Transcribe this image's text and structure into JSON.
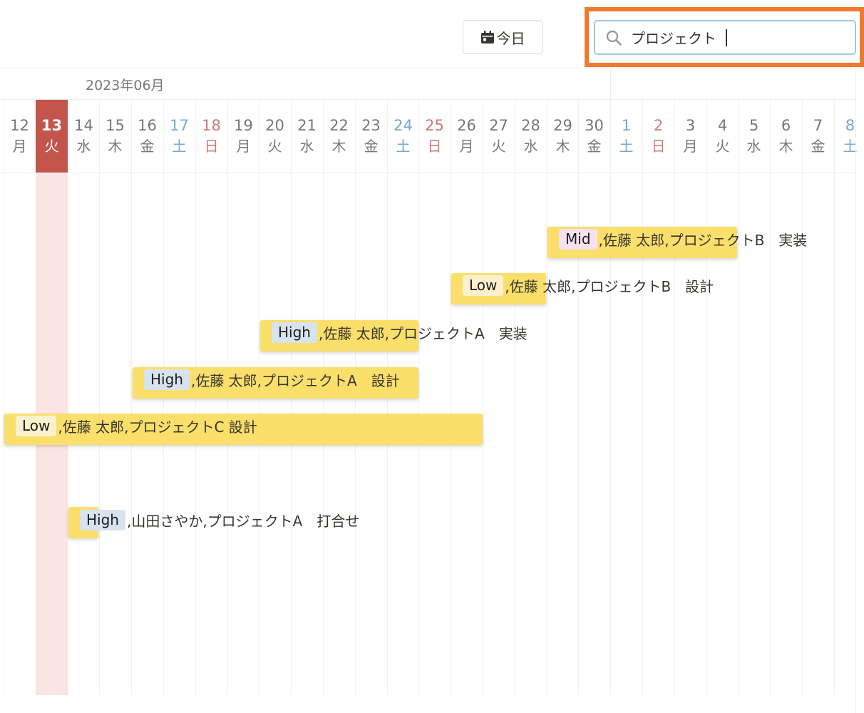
{
  "toolbar": {
    "today_label": "今日",
    "search_value": "プロジェクト"
  },
  "calendar": {
    "month_label": "2023年06月",
    "days": [
      {
        "num": "12",
        "wd": "月",
        "type": "normal"
      },
      {
        "num": "13",
        "wd": "火",
        "type": "today"
      },
      {
        "num": "14",
        "wd": "水",
        "type": "normal"
      },
      {
        "num": "15",
        "wd": "木",
        "type": "normal"
      },
      {
        "num": "16",
        "wd": "金",
        "type": "normal"
      },
      {
        "num": "17",
        "wd": "土",
        "type": "sat"
      },
      {
        "num": "18",
        "wd": "日",
        "type": "sun"
      },
      {
        "num": "19",
        "wd": "月",
        "type": "normal"
      },
      {
        "num": "20",
        "wd": "火",
        "type": "normal"
      },
      {
        "num": "21",
        "wd": "水",
        "type": "normal"
      },
      {
        "num": "22",
        "wd": "木",
        "type": "normal"
      },
      {
        "num": "23",
        "wd": "金",
        "type": "normal"
      },
      {
        "num": "24",
        "wd": "土",
        "type": "sat"
      },
      {
        "num": "25",
        "wd": "日",
        "type": "sun"
      },
      {
        "num": "26",
        "wd": "月",
        "type": "normal"
      },
      {
        "num": "27",
        "wd": "火",
        "type": "normal"
      },
      {
        "num": "28",
        "wd": "水",
        "type": "normal"
      },
      {
        "num": "29",
        "wd": "木",
        "type": "normal"
      },
      {
        "num": "30",
        "wd": "金",
        "type": "normal"
      },
      {
        "num": "1",
        "wd": "土",
        "type": "sat"
      },
      {
        "num": "2",
        "wd": "日",
        "type": "sun"
      },
      {
        "num": "3",
        "wd": "月",
        "type": "normal"
      },
      {
        "num": "4",
        "wd": "火",
        "type": "normal"
      },
      {
        "num": "5",
        "wd": "水",
        "type": "normal"
      },
      {
        "num": "6",
        "wd": "木",
        "type": "normal"
      },
      {
        "num": "7",
        "wd": "金",
        "type": "normal"
      },
      {
        "num": "8",
        "wd": "土",
        "type": "sat"
      }
    ],
    "colors": {
      "today": "#c4554d",
      "today_column": "#fbe4e4",
      "saturday": "#74a9cc",
      "sunday": "#cc7a78",
      "task_bar": "#fadf6b",
      "search_highlight": "#ee7a2f"
    }
  },
  "tasks": [
    {
      "priority": "Mid",
      "text": ",佐藤 太郎,プロジェクトB　実装"
    },
    {
      "priority": "Low",
      "text": ",佐藤 太郎,プロジェクトB　設計"
    },
    {
      "priority": "High",
      "text": ",佐藤 太郎,プロジェクトA　実装"
    },
    {
      "priority": "High",
      "text": ",佐藤 太郎,プロジェクトA　設計"
    },
    {
      "priority": "Low",
      "text": ",佐藤 太郎,プロジェクトC 設計"
    },
    {
      "priority": "High",
      "text": ",山田さやか,プロジェクトA　打合せ"
    }
  ]
}
